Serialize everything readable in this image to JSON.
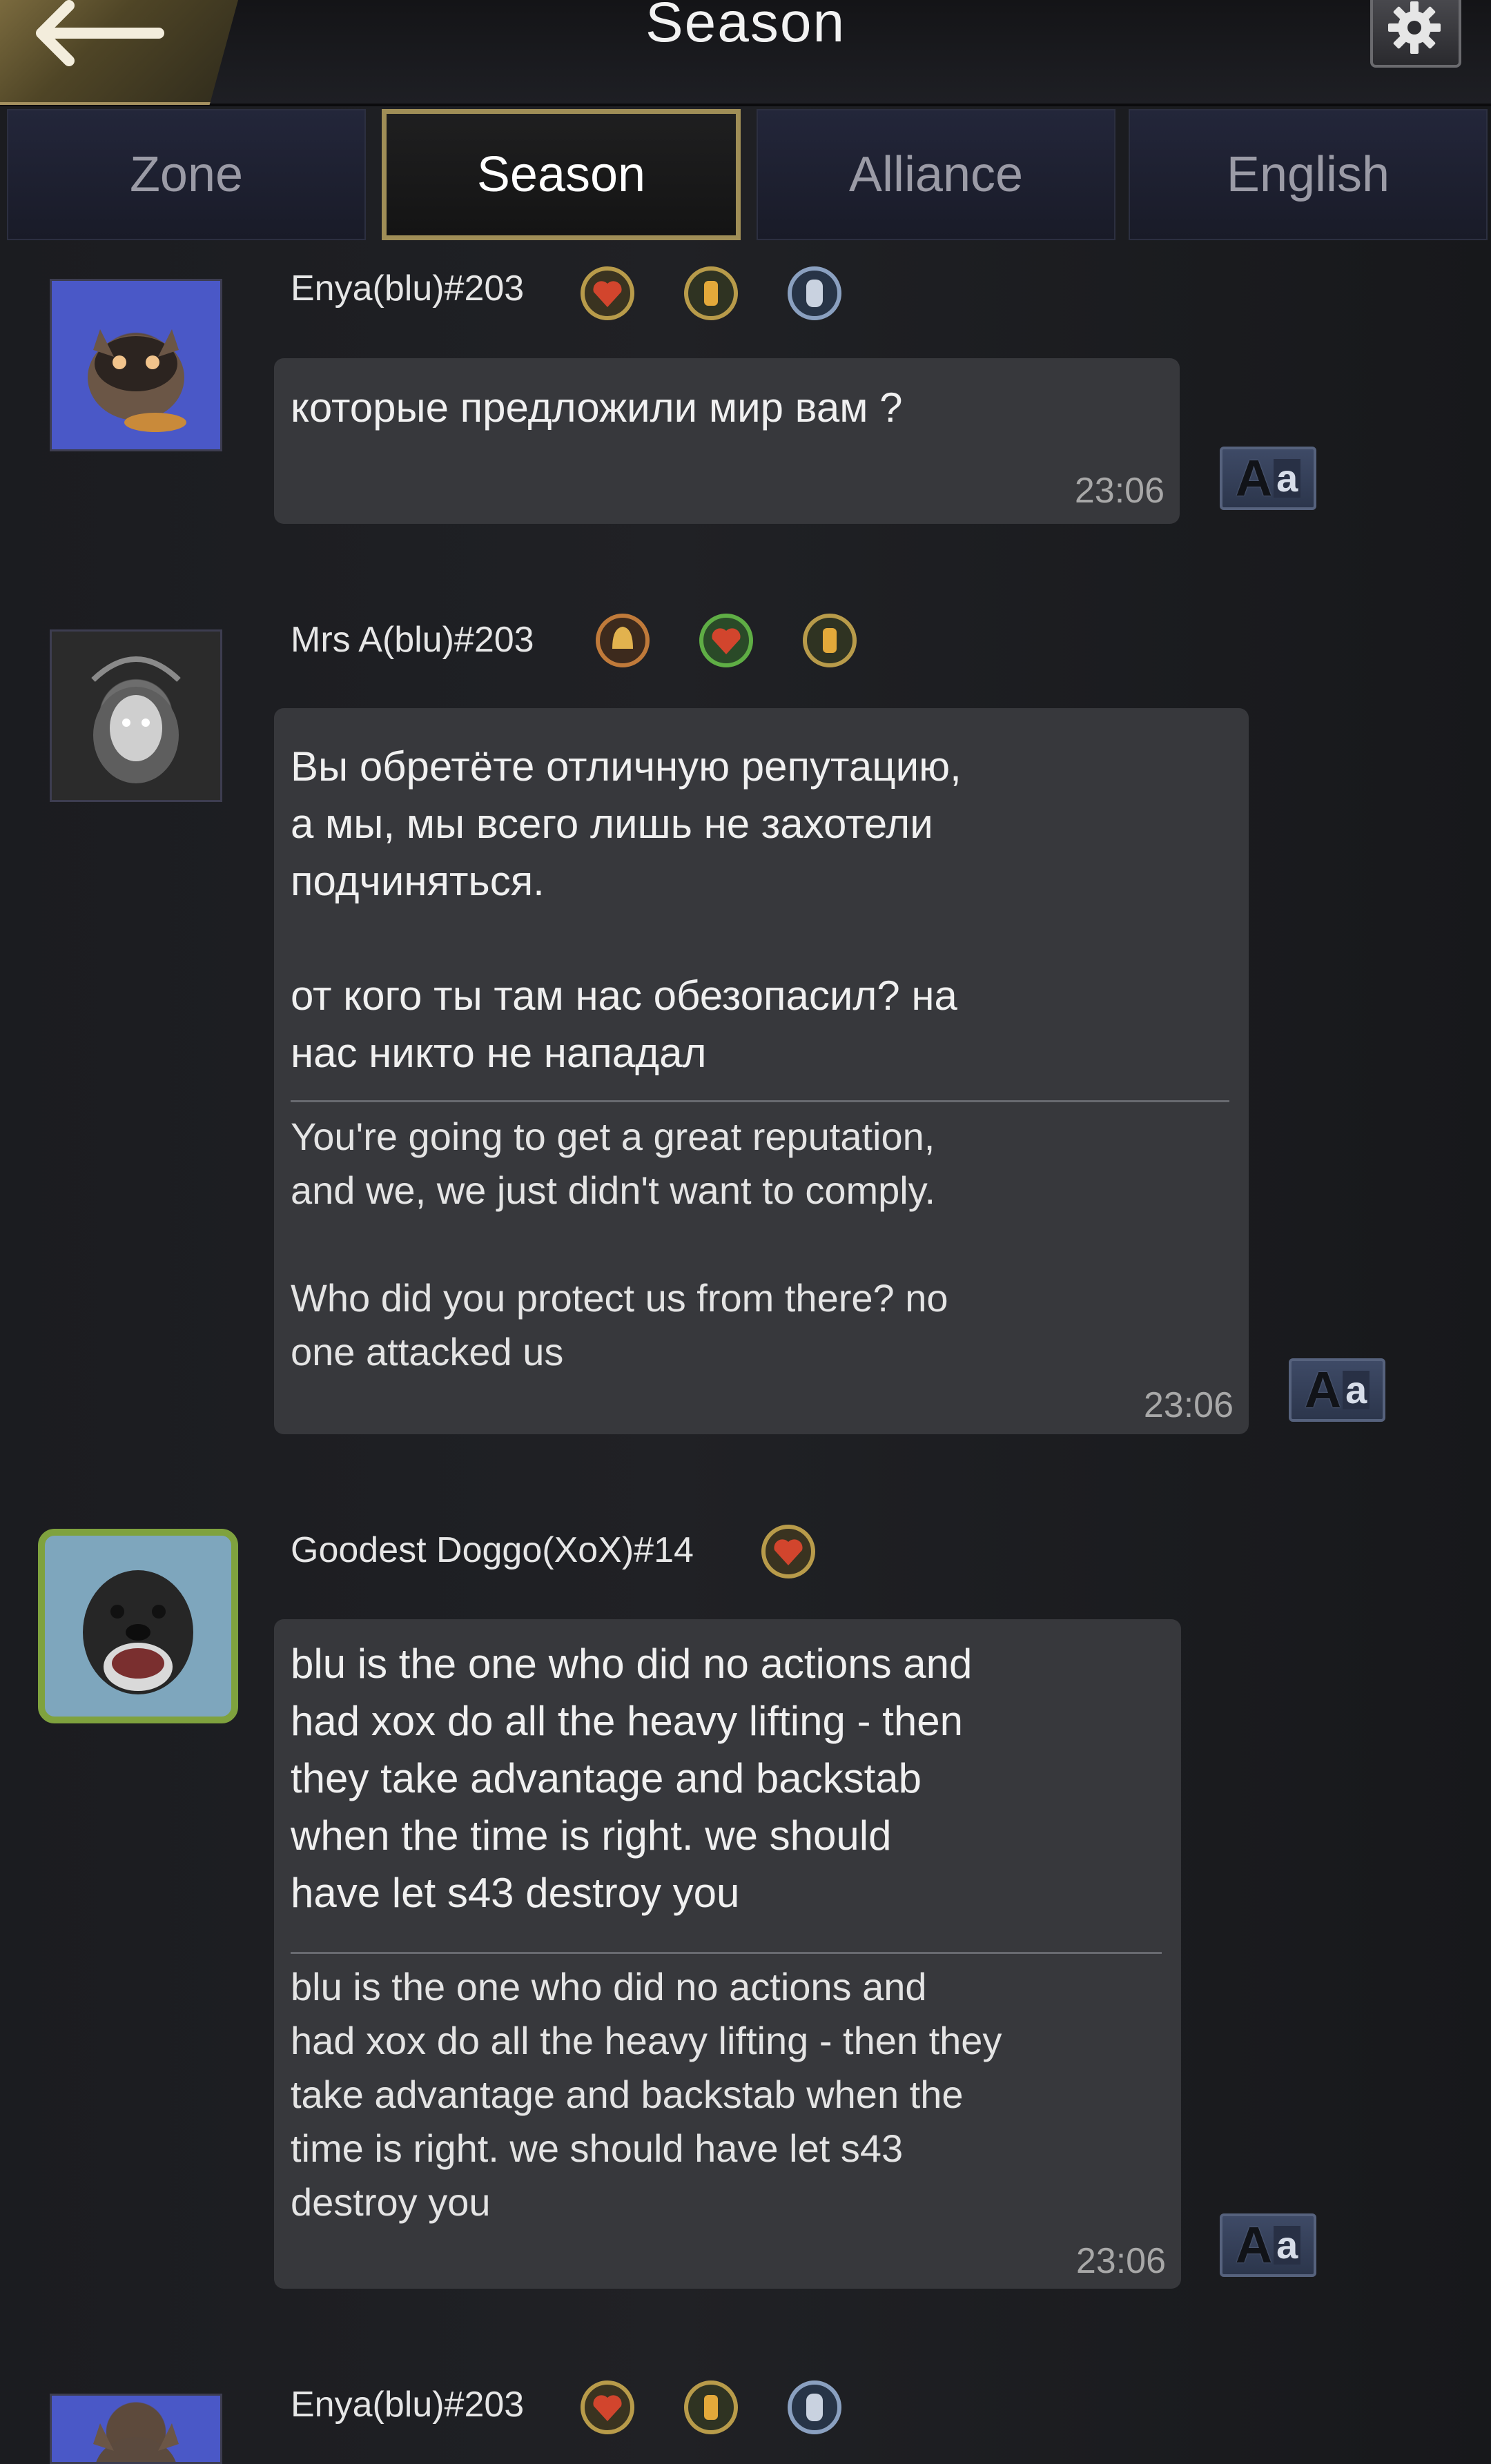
{
  "header": {
    "title": "Season",
    "back_icon": "back-arrow-icon",
    "settings_icon": "gear-icon"
  },
  "tabs": [
    {
      "label": "Zone",
      "active": false
    },
    {
      "label": "Season",
      "active": true
    },
    {
      "label": "Alliance",
      "active": false
    },
    {
      "label": "English",
      "active": false
    }
  ],
  "messages": [
    {
      "username": "Enya(blu)#203",
      "avatar": "raccoon-avatar",
      "badges": [
        "heart-shield-badge",
        "lantern-badge",
        "knight-badge"
      ],
      "text": "которые предложили мир вам ?",
      "translation": "",
      "time": "23:06",
      "translate_button": {
        "big": "A",
        "small": "a"
      }
    },
    {
      "username": "Mrs A(blu)#203",
      "avatar": "dark-woman-avatar",
      "badges": [
        "bell-badge",
        "clover-heart-badge",
        "lantern-badge"
      ],
      "text": "Вы обретёте отличную репутацию,\nа мы, мы всего лишь не захотели\nподчиняться.\n\nот кого ты там нас обезопасил? на\nнас никто не нападал",
      "translation": "You're going to get a great reputation,\nand we, we just didn't want to comply.\n\nWho did you protect us from there? no\none attacked us",
      "time": "23:06",
      "translate_button": {
        "big": "A",
        "small": "a"
      }
    },
    {
      "username": "Goodest Doggo(XoX)#14",
      "avatar": "dog-avatar",
      "badges": [
        "heart-shield-badge"
      ],
      "text": "blu is the one who did no actions and\nhad xox do all the heavy lifting - then\nthey take advantage and backstab\nwhen the time is right. we should\nhave let s43 destroy you",
      "translation": "blu is the one who did no actions and\nhad xox do all the heavy lifting - then they\n take advantage and backstab when the\ntime is right. we should have let s43\ndestroy you",
      "time": "23:06",
      "translate_button": {
        "big": "A",
        "small": "a"
      }
    },
    {
      "username": "Enya(blu)#203",
      "avatar": "raccoon-avatar",
      "badges": [
        "heart-shield-badge",
        "lantern-badge",
        "knight-badge"
      ]
    }
  ],
  "colors": {
    "background": "#1c1d21",
    "bubble": "#37383c",
    "tab_active_border": "#a08e57",
    "tab_bg": "#1f2232",
    "translate_btn": "#34405a"
  }
}
